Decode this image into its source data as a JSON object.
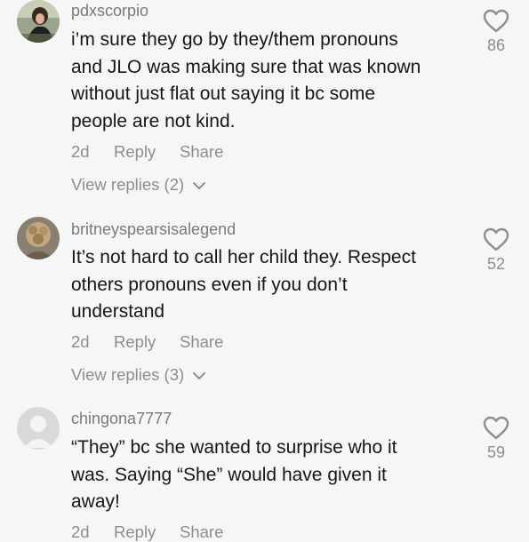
{
  "comments": [
    {
      "username": "pdxscorpio",
      "avatar_icon": "user-photo-avatar",
      "text_lines": [
        "i’m sure they go by they/them pronouns",
        "and JLO was making sure that was known",
        "without just flat out saying it bc some",
        "people are not kind."
      ],
      "time": "2d",
      "reply_label": "Reply",
      "share_label": "Share",
      "view_replies": "View replies (2)",
      "likes": "86"
    },
    {
      "username": "britneyspearsisalegend",
      "avatar_icon": "user-photo-avatar",
      "text_lines": [
        "It’s not hard to call her child they. Respect",
        "others pronouns even if you don’t",
        "understand"
      ],
      "time": "2d",
      "reply_label": "Reply",
      "share_label": "Share",
      "view_replies": "View replies (3)",
      "likes": "52"
    },
    {
      "username": "chingona7777",
      "avatar_icon": "default-user-avatar",
      "text_lines": [
        "“They” bc she wanted to surprise who it",
        "was. Saying “She” would have given it",
        "away!"
      ],
      "time": "2d",
      "reply_label": "Reply",
      "share_label": "Share",
      "likes": "59"
    }
  ],
  "colors": {
    "background": "#f6f6f6",
    "text": "#161616",
    "muted": "#8d8d8d",
    "username": "#7a7a7a"
  }
}
